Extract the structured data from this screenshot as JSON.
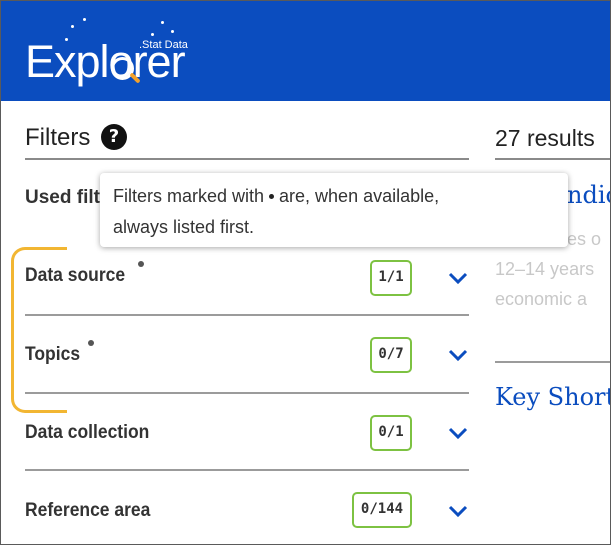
{
  "header": {
    "logo_text": "Explorer",
    "logo_subtitle": ".Stat Data",
    "background_color": "#0b4dbf",
    "accent_color": "#f4a12a"
  },
  "filters": {
    "title": "Filters",
    "help_icon": "question-circle-icon",
    "used_filters_label": "Used filt",
    "items": [
      {
        "label": "Data source",
        "count": "1/1",
        "pinned": true
      },
      {
        "label": "Topics",
        "count": "0/7",
        "pinned": true
      },
      {
        "label": "Data collection",
        "count": "0/1",
        "pinned": false
      },
      {
        "label": "Reference area",
        "count": "0/144",
        "pinned": false
      }
    ],
    "chevron_icon": "chevron-down-icon",
    "count_border_color": "#7dc242",
    "pinned_bracket_color": "#f2b632"
  },
  "tooltip": {
    "line1_before": "Filters marked with",
    "line1_after": "are, when available,",
    "line2": "always listed first."
  },
  "results": {
    "count_text": "27 results",
    "first_title": "ndic",
    "first_desc_lines": [
      "es o",
      "12–14 years",
      "economic a"
    ],
    "second_title": "Key Short"
  }
}
